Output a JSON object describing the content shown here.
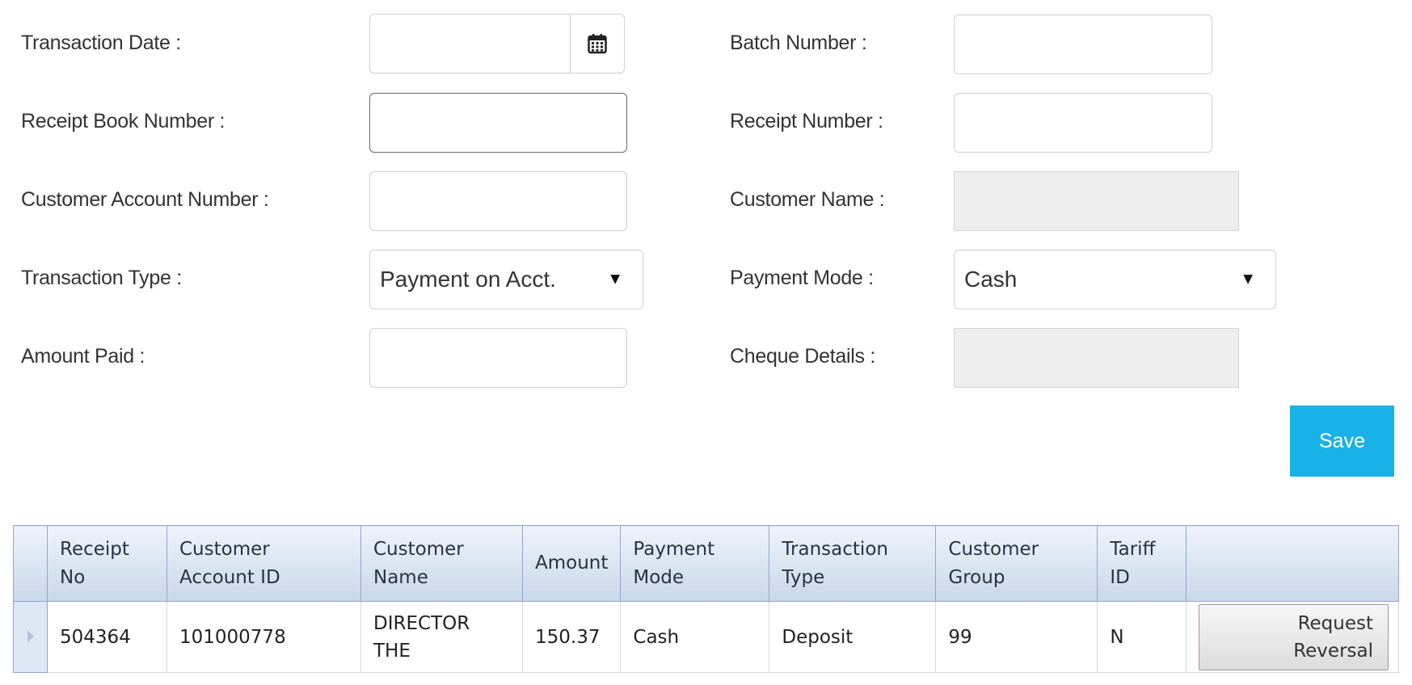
{
  "form": {
    "transaction_date": {
      "label": "Transaction Date :",
      "value": ""
    },
    "batch_number": {
      "label": "Batch Number :",
      "value": ""
    },
    "receipt_book_number": {
      "label": "Receipt Book Number :",
      "value": ""
    },
    "receipt_number": {
      "label": "Receipt Number :",
      "value": ""
    },
    "customer_account_number": {
      "label": "Customer Account Number :",
      "value": ""
    },
    "customer_name": {
      "label": "Customer Name :",
      "value": ""
    },
    "transaction_type": {
      "label": "Transaction Type :",
      "selected": "Payment on Acct."
    },
    "payment_mode": {
      "label": "Payment Mode :",
      "selected": "Cash"
    },
    "amount_paid": {
      "label": "Amount Paid :",
      "value": ""
    },
    "cheque_details": {
      "label": "Cheque Details :",
      "value": ""
    },
    "save_label": "Save"
  },
  "table": {
    "headers": [
      "Receipt No",
      "Customer Account ID",
      "Customer Name",
      "Amount",
      "Payment Mode",
      "Transaction Type",
      "Customer Group",
      "Tariff ID",
      ""
    ],
    "header_lines": [
      [
        "Receipt",
        "No"
      ],
      [
        "Customer",
        "Account ID"
      ],
      [
        "Customer",
        "Name"
      ],
      [
        "Amount"
      ],
      [
        "Payment",
        "Mode"
      ],
      [
        "Transaction",
        "Type"
      ],
      [
        "Customer",
        "Group"
      ],
      [
        "Tariff",
        "ID"
      ]
    ],
    "rows": [
      {
        "receipt_no": "504364",
        "customer_account_id": "101000778",
        "customer_name_lines": [
          "DIRECTOR",
          "THE"
        ],
        "amount": "150.37",
        "payment_mode": "Cash",
        "transaction_type": "Deposit",
        "customer_group": "99",
        "tariff_id": "N",
        "action_label": "Request Reversal"
      }
    ]
  },
  "colors": {
    "save_button": "#1ab2e6",
    "table_header_top": "#eef3fa",
    "table_header_bottom": "#c8d7ea",
    "table_border": "#94a6c4"
  }
}
